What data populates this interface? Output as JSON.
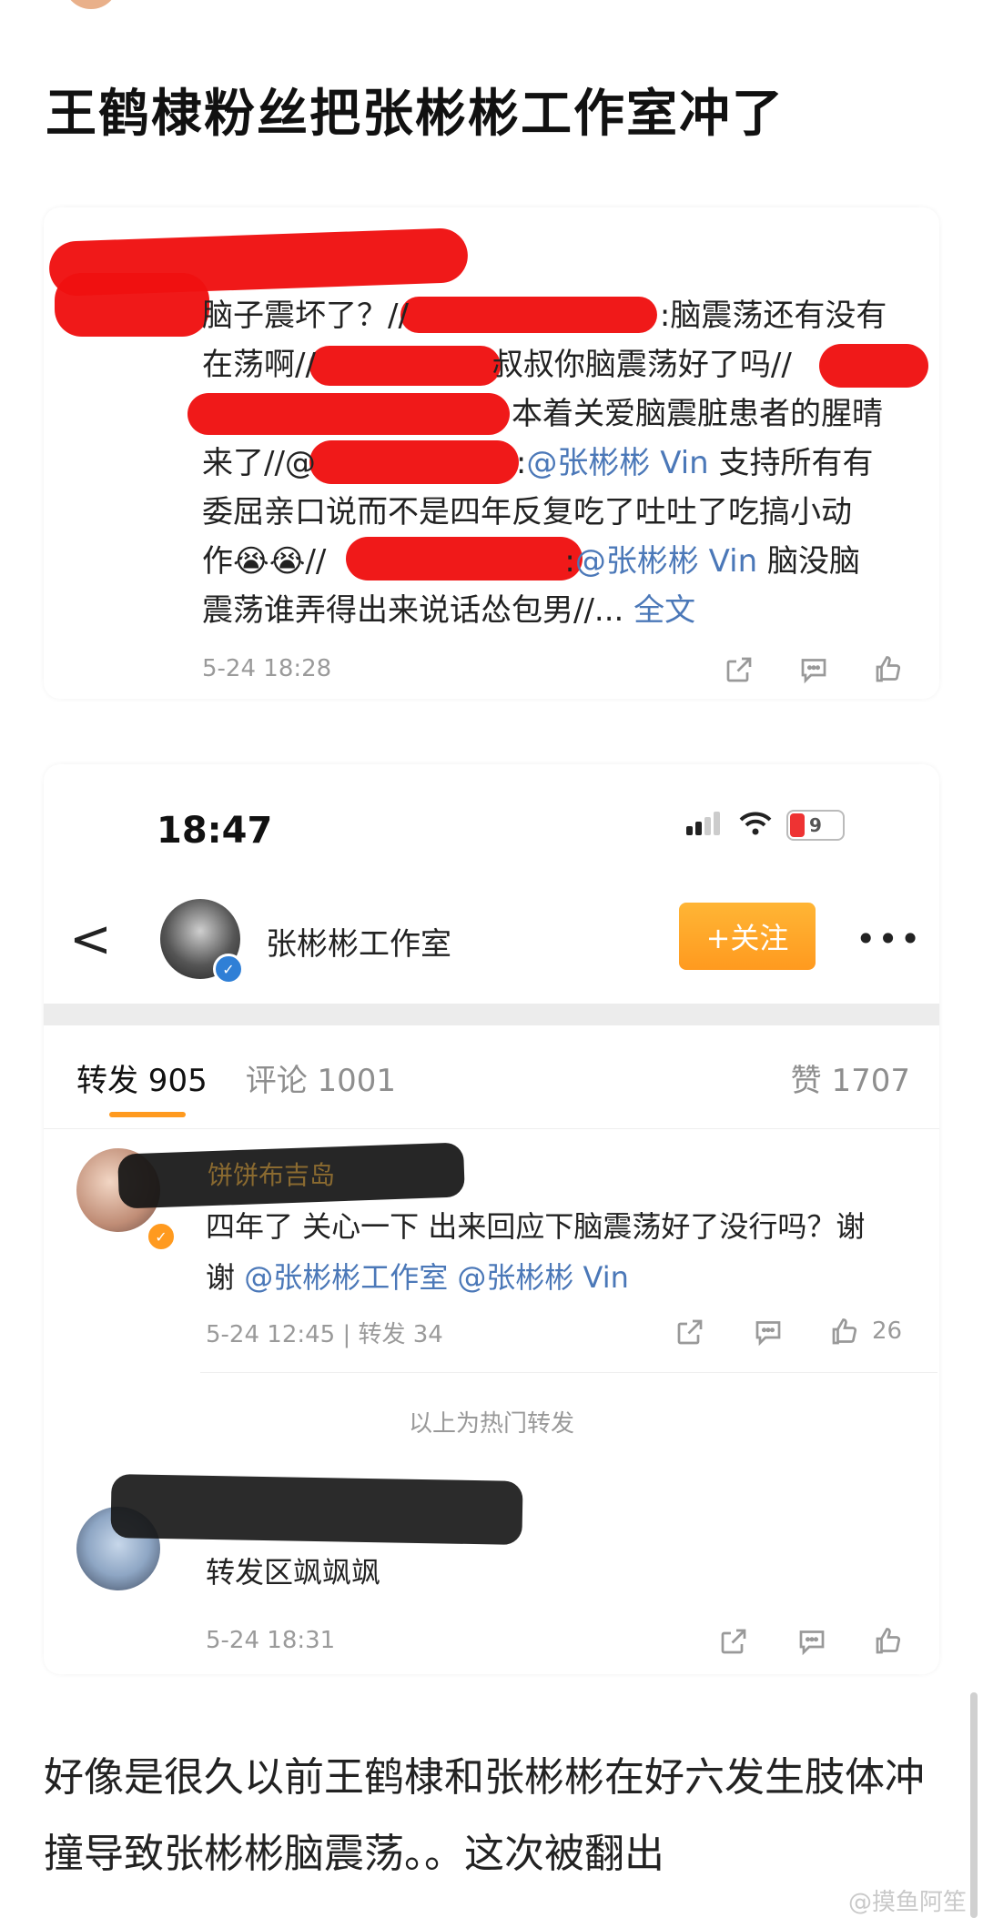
{
  "article": {
    "title": "王鹤棣粉丝把张彬彬工作室冲了"
  },
  "repost_card": {
    "line1_a": "脑子震坏了？//",
    "line1_b": ":脑震荡还有没有",
    "line2_a": "在荡啊//",
    "line2_b": "叔叔你脑震荡好了吗//",
    "line3_b": "本着关爱脑震脏患者的腥晴",
    "line4_a": "来了//@",
    "line4_b": ":",
    "mention_zbb": "@张彬彬 Vin",
    "line4_c": " 支持所有有",
    "line5": "委屈亲口说而不是四年反复吃了吐吐了吃搞小动",
    "line6_a": "作",
    "emoji": "😭",
    "line6_b": "//",
    "line6_c": ":",
    "line6_d": " 脑没脑",
    "line7": "震荡谁弄得出来说话怂包男//...",
    "full_text_link": "全文",
    "time": "5-24 18:28"
  },
  "screenshot": {
    "status_time": "18:47",
    "battery_level": "9",
    "profile_name": "张彬彬工作室",
    "verified_mark": "✓",
    "follow_label": "+关注",
    "more_label": "•••",
    "back_label": "<",
    "tabs": {
      "repost": "转发 905",
      "comment": "评论 1001",
      "like": "赞 1707"
    },
    "comment1": {
      "username": "饼饼布吉岛",
      "text": "四年了 关心一下 出来回应下脑震荡好了没行吗？谢谢",
      "mention_studio": "@张彬彬工作室",
      "mention_vin": "@张彬彬 Vin",
      "meta": "5-24 12:45 | 转发 34",
      "likes": "26"
    },
    "hot_label": "以上为热门转发",
    "comment2": {
      "text": "转发区飒飒飒",
      "time": "5-24 18:31"
    }
  },
  "bottom_text": "好像是很久以前王鹤棣和张彬彬在好六发生肢体冲撞导致张彬彬脑震荡。。这次被翻出",
  "watermark": "@摸鱼阿笙"
}
